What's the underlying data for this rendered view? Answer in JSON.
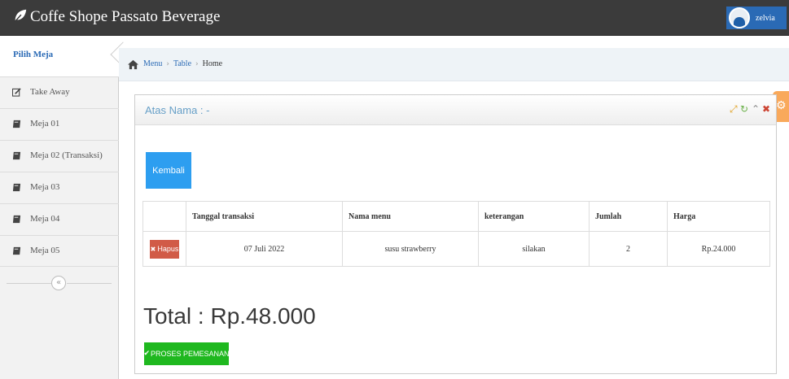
{
  "app": {
    "title": "Coffe Shope Passato Beverage"
  },
  "user": {
    "name": "zelvia"
  },
  "sidebar": {
    "active_label": "Pilih Meja",
    "items": [
      {
        "label": "Take Away",
        "icon": "pencil-square-icon"
      },
      {
        "label": "Meja 01",
        "icon": "book-icon"
      },
      {
        "label": "Meja 02 (Transaksi)",
        "icon": "book-icon"
      },
      {
        "label": "Meja 03",
        "icon": "book-icon"
      },
      {
        "label": "Meja 04",
        "icon": "book-icon"
      },
      {
        "label": "Meja 05",
        "icon": "book-icon"
      }
    ],
    "collapse_glyph": "«"
  },
  "breadcrumb": {
    "items": [
      "Menu",
      "Table",
      "Home"
    ],
    "separator": "›"
  },
  "widget": {
    "title": "Atas Nama : -",
    "back_button": "Kembali",
    "table": {
      "headers": [
        "",
        "Tanggal transaksi",
        "Nama menu",
        "keterangan",
        "Jumlah",
        "Harga"
      ],
      "rows": [
        {
          "action": "Hapus",
          "tanggal": "07 Juli 2022",
          "nama_menu": "susu strawberry",
          "keterangan": "silakan",
          "jumlah": "2",
          "harga": "Rp.24.000"
        }
      ]
    },
    "total": "Total : Rp.48.000",
    "process_button": "PROSES PEMESANAN"
  },
  "colors": {
    "navbar": "#3b3b3b",
    "accent": "#2a6ab5",
    "kembali": "#2d9ef0",
    "hapus": "#d15b47",
    "proses": "#1fb81f",
    "settings": "#f9a95b"
  }
}
